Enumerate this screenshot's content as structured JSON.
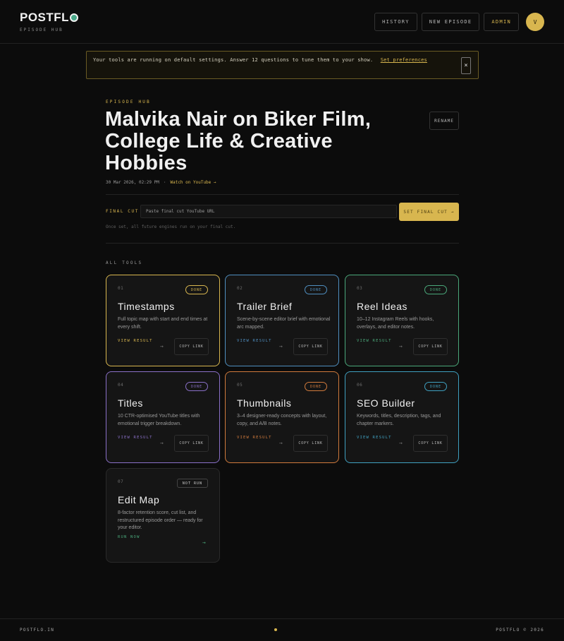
{
  "header": {
    "logo_text": "POSTFL",
    "logo_sub": "EPISODE HUB",
    "nav": {
      "history": "HISTORY",
      "new_episode": "NEW EPISODE",
      "admin": "ADMIN"
    },
    "avatar_initial": "V"
  },
  "banner": {
    "text": "Your tools are running on default settings. Answer 12 questions to tune them to your show.",
    "link": "Set preferences",
    "close": "×"
  },
  "episode": {
    "eyebrow": "EPISODE HUB",
    "title": "Malvika Nair on Biker Film, College Life & Creative Hobbies",
    "rename": "RENAME",
    "date": "30 Mar 2026, 02:29 PM",
    "separator": "·",
    "youtube_link": "Watch on YouTube →"
  },
  "final_cut": {
    "label": "FINAL CUT",
    "placeholder": "Paste final cut YouTube URL",
    "button": "SET FINAL CUT →",
    "help": "Once set, all future engines run on your final cut."
  },
  "tools_label": "ALL TOOLS",
  "tools": [
    {
      "num": "01",
      "status": "DONE",
      "title": "Timestamps",
      "desc": "Full topic map with start and end times at every shift.",
      "action": "VIEW RESULT",
      "arrow": "→",
      "copy": "COPY LINK",
      "color": "#d8b64f"
    },
    {
      "num": "02",
      "status": "DONE",
      "title": "Trailer Brief",
      "desc": "Scene-by-scene editor brief with emotional arc mapped.",
      "action": "VIEW RESULT",
      "arrow": "→",
      "copy": "COPY LINK",
      "color": "#4f8fc0"
    },
    {
      "num": "03",
      "status": "DONE",
      "title": "Reel Ideas",
      "desc": "10–12 Instagram Reels with hooks, overlays, and editor notes.",
      "action": "VIEW RESULT",
      "arrow": "→",
      "copy": "COPY LINK",
      "color": "#4aa87a"
    },
    {
      "num": "04",
      "status": "DONE",
      "title": "Titles",
      "desc": "10 CTR-optimised YouTube titles with emotional trigger breakdown.",
      "action": "VIEW RESULT",
      "arrow": "→",
      "copy": "COPY LINK",
      "color": "#8a70c8"
    },
    {
      "num": "05",
      "status": "DONE",
      "title": "Thumbnails",
      "desc": "3–4 designer-ready concepts with layout, copy, and A/B notes.",
      "action": "VIEW RESULT",
      "arrow": "→",
      "copy": "COPY LINK",
      "color": "#d07a3c"
    },
    {
      "num": "06",
      "status": "DONE",
      "title": "SEO Builder",
      "desc": "Keywords, titles, description, tags, and chapter markers.",
      "action": "VIEW RESULT",
      "arrow": "→",
      "copy": "COPY LINK",
      "color": "#3fa0c0"
    },
    {
      "num": "07",
      "status": "NOT RUN",
      "title": "Edit Map",
      "desc": "8-factor retention score, cut list, and restructured episode order — ready for your editor.",
      "action": "RUN NOW",
      "arrow": "→",
      "copy": "",
      "color": "#4aa87a"
    }
  ],
  "footer": {
    "left": "POSTFLO.IN",
    "right": "POSTFLO © 2026"
  },
  "colors": {
    "accent": "#d8b64f",
    "background": "#0c0c0c"
  }
}
